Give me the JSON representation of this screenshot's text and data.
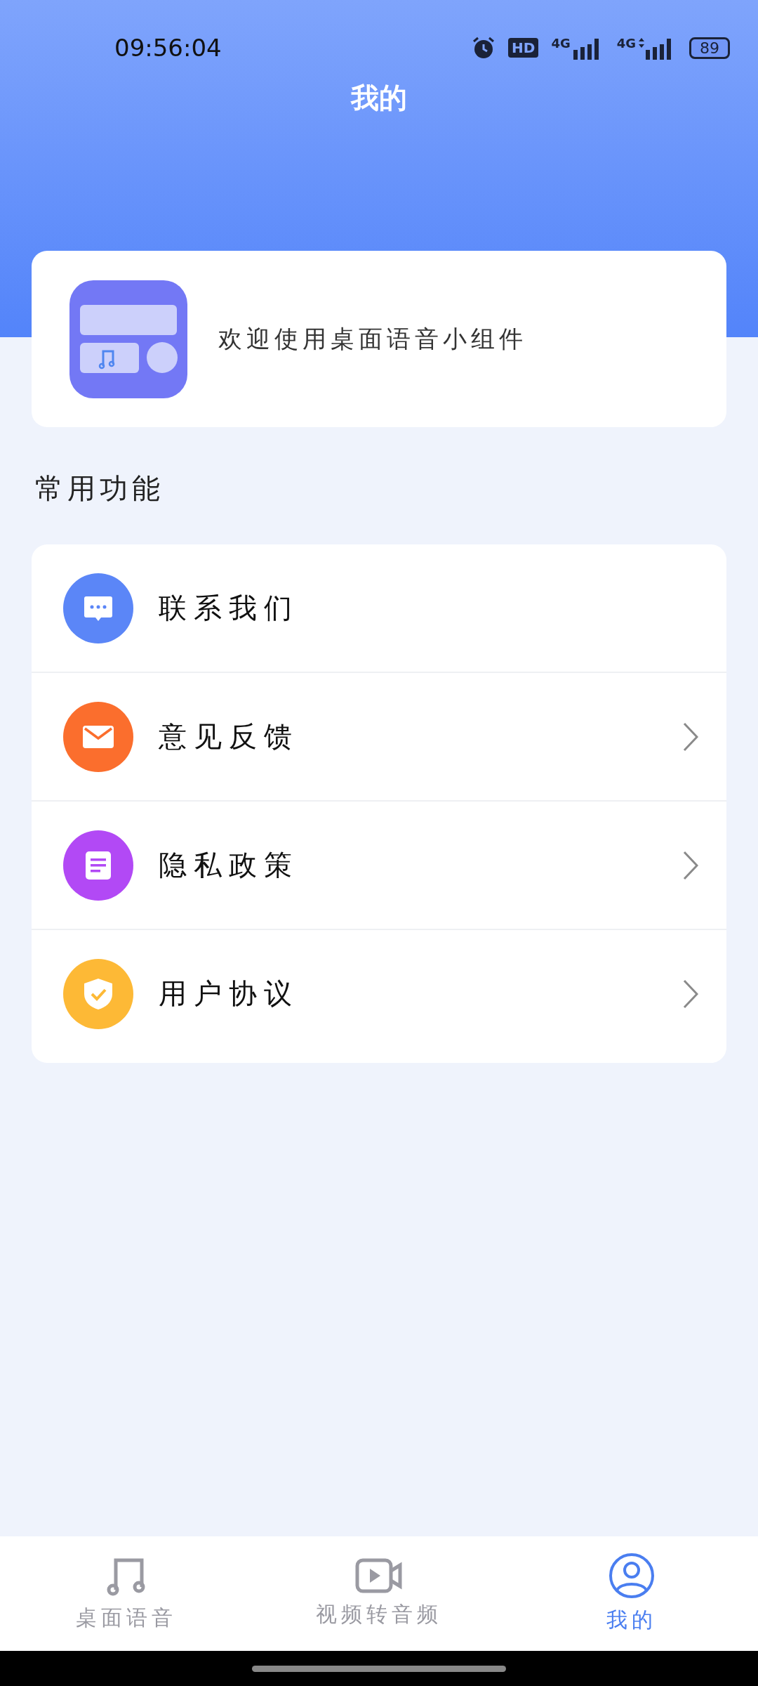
{
  "status_bar": {
    "time": "09:56:04",
    "hd": "HD",
    "networks": [
      "4G",
      "4G"
    ],
    "battery": "89"
  },
  "title": "我的",
  "welcome": {
    "text": "欢迎使用桌面语音小组件"
  },
  "section_title": "常用功能",
  "menu": [
    {
      "kind": "chat",
      "label": "联系我们",
      "color": "#5b86f7",
      "arrow": false
    },
    {
      "kind": "mail",
      "label": "意见反馈",
      "color": "#fb6e2d",
      "arrow": true
    },
    {
      "kind": "doc",
      "label": "隐私政策",
      "color": "#b249f5",
      "arrow": true
    },
    {
      "kind": "shield",
      "label": "用户协议",
      "color": "#fdb936",
      "arrow": true
    }
  ],
  "tabs": [
    {
      "kind": "music",
      "label": "桌面语音",
      "selected": false
    },
    {
      "kind": "video",
      "label": "视频转音频",
      "selected": false
    },
    {
      "kind": "user",
      "label": "我的",
      "selected": true
    }
  ]
}
